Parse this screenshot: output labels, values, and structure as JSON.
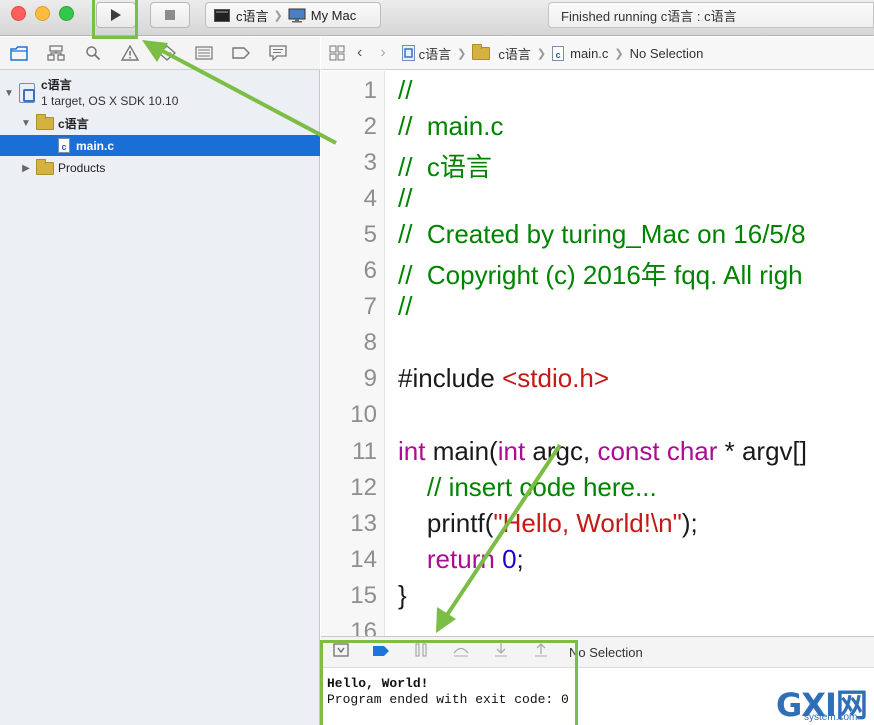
{
  "toolbar": {
    "scheme_target": "c语言",
    "scheme_device": "My Mac",
    "status_text": "Finished running c语言 : c语言"
  },
  "navigator": {
    "project_name": "c语言",
    "project_subtitle": "1 target, OS X SDK 10.10",
    "group_name": "c语言",
    "selected_file": "main.c",
    "products_label": "Products"
  },
  "jumpbar": {
    "crumb1": "c语言",
    "crumb2": "c语言",
    "crumb3": "main.c",
    "crumb4": "No Selection"
  },
  "editor": {
    "line_numbers": [
      "1",
      "2",
      "3",
      "4",
      "5",
      "6",
      "7",
      "8",
      "9",
      "10",
      "11",
      "12",
      "13",
      "14",
      "15",
      "16"
    ],
    "lines": {
      "l1": "//",
      "l2": "//  main.c",
      "l3": "//  c语言",
      "l4": "//",
      "l5": "//  Created by turing_Mac on 16/5/8",
      "l6": "//  Copyright (c) 2016年 fqq. All righ",
      "l7": "//",
      "l9_directive": "#include ",
      "l9_header": "<stdio.h>",
      "l11_int": "int",
      "l11_main": " main(",
      "l11_int2": "int",
      "l11_argc": " argc, ",
      "l11_const": "const",
      "l11_char": "char",
      "l11_rest": " * argv[]",
      "l12": "    // insert code here...",
      "l13_printf": "    printf(",
      "l13_str": "\"Hello, World!\\n\"",
      "l13_end": ");",
      "l14_return": "    return",
      "l14_zero": "0",
      "l14_end": ";",
      "l15": "}"
    }
  },
  "debug": {
    "no_selection": "No Selection"
  },
  "console": {
    "line1": "Hello, World!",
    "line2": "Program ended with exit code: 0"
  },
  "watermark": {
    "main": "GXI网",
    "sub": "system.com"
  },
  "colors": {
    "annotation": "#7cbd45",
    "selection": "#1a6fd6",
    "comment": "#008400",
    "keyword": "#aa0d91",
    "string": "#c41a16"
  }
}
